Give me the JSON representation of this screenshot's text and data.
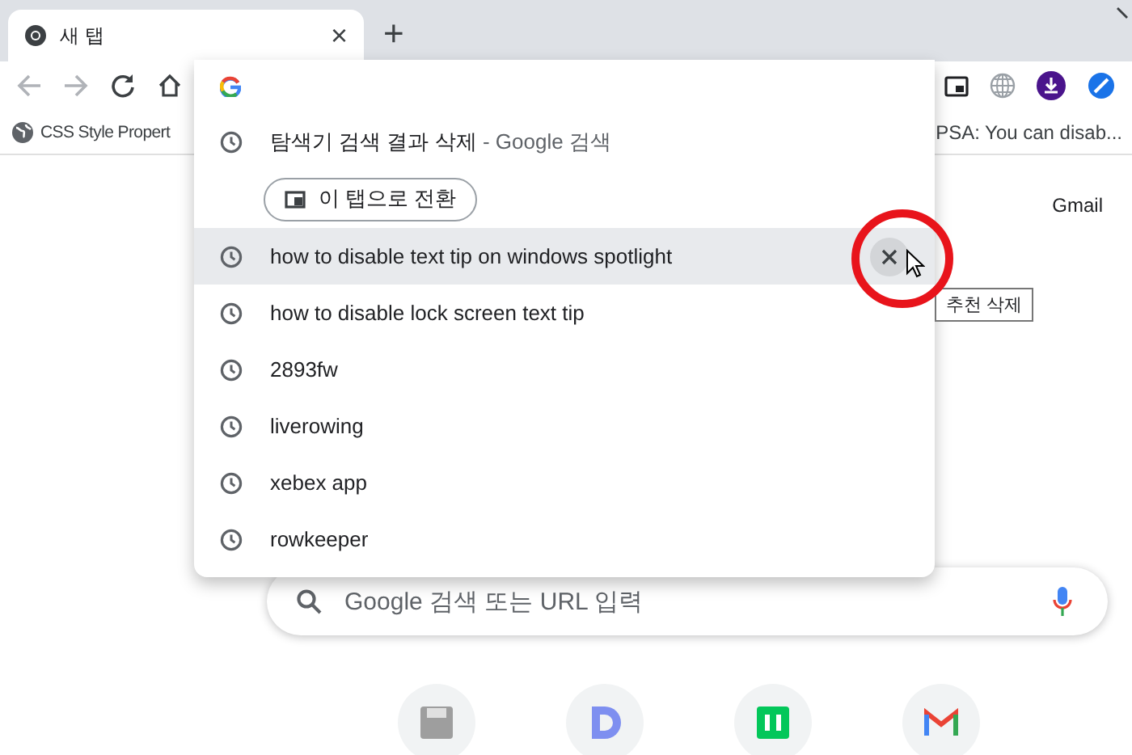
{
  "tab": {
    "title": "새 탭",
    "close": "×"
  },
  "new_tab": "+",
  "bookmarks": [
    {
      "label": "CSS Style Propert",
      "kind": "site"
    },
    {
      "label": "PSA: You can disab...",
      "kind": "plain"
    }
  ],
  "omnibox_dropdown": {
    "suggestions": [
      {
        "kind": "tab",
        "text": "탐색기 검색 결과 삭제",
        "suffix": "- Google 검색",
        "action": "이 탭으로 전환",
        "selected": false
      },
      {
        "kind": "history",
        "text": "how to disable text tip on windows spotlight",
        "selected": true
      },
      {
        "kind": "history",
        "text": "how to disable lock screen text tip",
        "selected": false
      },
      {
        "kind": "history",
        "text": "2893fw",
        "selected": false
      },
      {
        "kind": "history",
        "text": "liverowing",
        "selected": false
      },
      {
        "kind": "history",
        "text": "xebex app",
        "selected": false
      },
      {
        "kind": "history",
        "text": "rowkeeper",
        "selected": false
      }
    ]
  },
  "tooltip": "추천 삭제",
  "gmail": "Gmail",
  "search": {
    "placeholder": "Google 검색 또는 URL 입력"
  }
}
